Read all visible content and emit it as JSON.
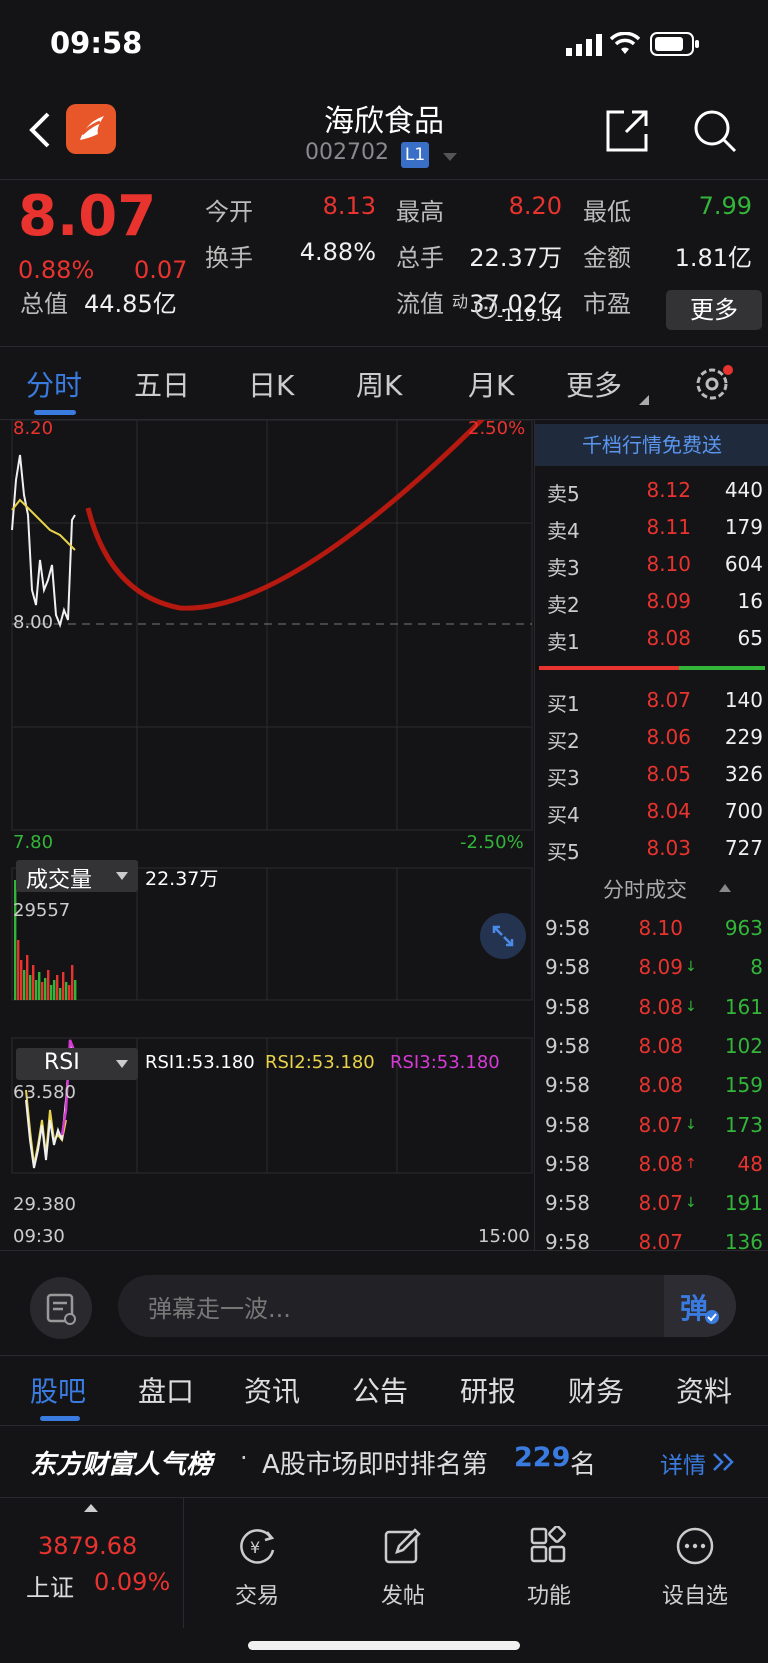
{
  "status": {
    "time": "09:58"
  },
  "header": {
    "title": "海欣食品",
    "code": "002702",
    "level_badge": "L1"
  },
  "quote": {
    "price": "8.07",
    "change_pct": "0.88%",
    "change": "0.07",
    "stats": [
      {
        "label": "今开",
        "value": "8.13",
        "color": "red"
      },
      {
        "label": "最高",
        "value": "8.20",
        "color": "red"
      },
      {
        "label": "最低",
        "value": "7.99",
        "color": "green"
      },
      {
        "label": "换手",
        "value": "4.88%",
        "color": "white"
      },
      {
        "label": "总手",
        "value": "22.37万",
        "color": "white"
      },
      {
        "label": "金额",
        "value": "1.81亿",
        "color": "white"
      },
      {
        "label": "总值",
        "value": "44.85亿",
        "color": "white"
      },
      {
        "label": "流值",
        "value": "37.02亿",
        "color": "white"
      },
      {
        "label": "市盈",
        "value": "-119.34",
        "color": "white"
      }
    ],
    "pe_superscript": "动",
    "more_button": "更多"
  },
  "tabs": [
    "分时",
    "五日",
    "日K",
    "周K",
    "月K",
    "更多"
  ],
  "chart": {
    "price_high": "8.20",
    "price_mid": "8.00",
    "price_low": "7.80",
    "pct_high": "2.50%",
    "pct_low": "-2.50%",
    "volume_label": "成交量",
    "volume_value": "22.37万",
    "volume_max": "29557",
    "rsi_label": "RSI",
    "rsi1": "RSI1:53.180",
    "rsi2": "RSI2:53.180",
    "rsi3": "RSI3:53.180",
    "rsi_high": "63.580",
    "rsi_low": "29.380",
    "time_start": "09:30",
    "time_end": "15:00"
  },
  "chart_data": {
    "type": "line",
    "series": [],
    "x_range": [
      "09:30",
      "15:00"
    ],
    "ylim": [
      7.8,
      8.2
    ]
  },
  "orderbook": {
    "banner": "千档行情免费送",
    "asks": [
      {
        "label": "卖5",
        "price": "8.12",
        "vol": "440"
      },
      {
        "label": "卖4",
        "price": "8.11",
        "vol": "179"
      },
      {
        "label": "卖3",
        "price": "8.10",
        "vol": "604"
      },
      {
        "label": "卖2",
        "price": "8.09",
        "vol": "16"
      },
      {
        "label": "卖1",
        "price": "8.08",
        "vol": "65"
      }
    ],
    "bids": [
      {
        "label": "买1",
        "price": "8.07",
        "vol": "140"
      },
      {
        "label": "买2",
        "price": "8.06",
        "vol": "229"
      },
      {
        "label": "买3",
        "price": "8.05",
        "vol": "326"
      },
      {
        "label": "买4",
        "price": "8.04",
        "vol": "700"
      },
      {
        "label": "买5",
        "price": "8.03",
        "vol": "727"
      }
    ],
    "ticks_title": "分时成交",
    "ticks": [
      {
        "time": "9:58",
        "price": "8.10",
        "arrow": "",
        "vol": "963",
        "vcolor": "green"
      },
      {
        "time": "9:58",
        "price": "8.09",
        "arrow": "↓",
        "vol": "8",
        "vcolor": "green"
      },
      {
        "time": "9:58",
        "price": "8.08",
        "arrow": "↓",
        "vol": "161",
        "vcolor": "green"
      },
      {
        "time": "9:58",
        "price": "8.08",
        "arrow": "",
        "vol": "102",
        "vcolor": "green"
      },
      {
        "time": "9:58",
        "price": "8.08",
        "arrow": "",
        "vol": "159",
        "vcolor": "green"
      },
      {
        "time": "9:58",
        "price": "8.07",
        "arrow": "↓",
        "vol": "173",
        "vcolor": "green"
      },
      {
        "time": "9:58",
        "price": "8.08",
        "arrow": "↑",
        "vol": "48",
        "vcolor": "red"
      },
      {
        "time": "9:58",
        "price": "8.07",
        "arrow": "↓",
        "vol": "191",
        "vcolor": "green"
      },
      {
        "time": "9:58",
        "price": "8.07",
        "arrow": "",
        "vol": "136",
        "vcolor": "green"
      }
    ]
  },
  "danmu": {
    "placeholder": "弹幕走一波...",
    "send_glyph": "弹"
  },
  "bottom_tabs": [
    "股吧",
    "盘口",
    "资讯",
    "公告",
    "研报",
    "财务",
    "资料"
  ],
  "rank": {
    "brand": "东方财富人气榜",
    "text_prefix": "A股市场即时排名第",
    "rank": "229",
    "text_suffix": "名",
    "link": "详情"
  },
  "nav": {
    "index_value": "3879.68",
    "index_name": "上证",
    "index_pct": "0.09%",
    "items": [
      {
        "label": "交易",
        "icon": "trade-icon"
      },
      {
        "label": "发帖",
        "icon": "post-icon"
      },
      {
        "label": "功能",
        "icon": "apps-icon"
      },
      {
        "label": "设自选",
        "icon": "add-watchlist-icon"
      }
    ]
  }
}
